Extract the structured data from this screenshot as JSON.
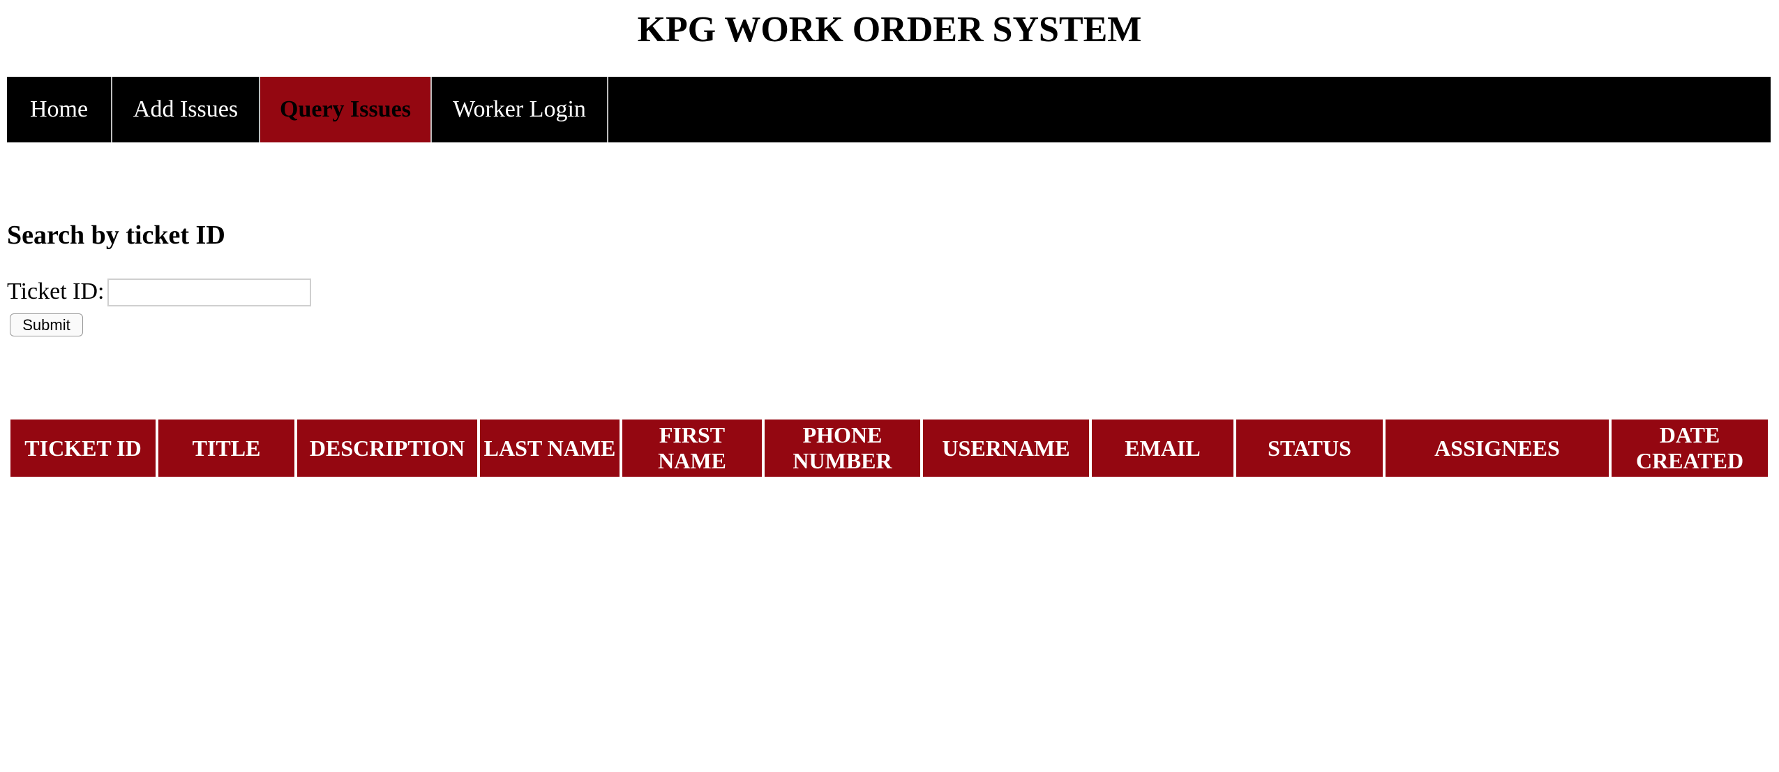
{
  "site": {
    "title": "KPG WORK ORDER SYSTEM"
  },
  "nav": {
    "items": [
      {
        "label": "Home",
        "active": false
      },
      {
        "label": "Add Issues",
        "active": false
      },
      {
        "label": "Query Issues",
        "active": true
      },
      {
        "label": "Worker Login",
        "active": false
      }
    ]
  },
  "search": {
    "heading": "Search by ticket ID",
    "label": "Ticket ID:",
    "value": "",
    "submit_label": "Submit"
  },
  "table": {
    "columns": [
      "TICKET ID",
      "TITLE",
      "DESCRIPTION",
      "LAST NAME",
      "FIRST NAME",
      "PHONE NUMBER",
      "USERNAME",
      "EMAIL",
      "STATUS",
      "ASSIGNEES",
      "DATE CREATED"
    ],
    "rows": []
  },
  "colors": {
    "nav_background": "#000000",
    "accent": "#940711",
    "header_text": "#ffffff"
  }
}
